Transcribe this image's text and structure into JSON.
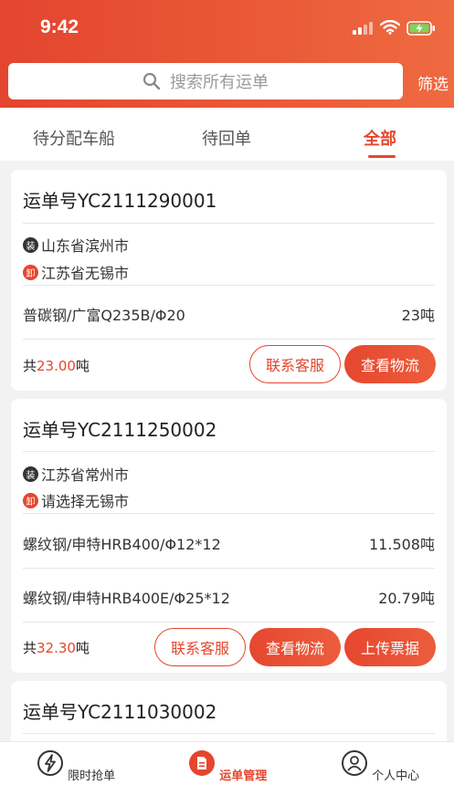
{
  "status_bar": {
    "time": "9:42"
  },
  "search": {
    "placeholder": "搜索所有运单",
    "filter_label": "筛选"
  },
  "tabs": [
    {
      "label": "待分配车船"
    },
    {
      "label": "待回单"
    },
    {
      "label": "全部",
      "active": true
    }
  ],
  "orders": [
    {
      "order_no": "运单号YC2111290001",
      "load_badge": "装",
      "load_address": "山东省滨州市",
      "unload_badge": "卸",
      "unload_address": "江苏省无锡市",
      "items": [
        {
          "name": "普碳钢/广富Q235B/Φ20",
          "weight": "23吨"
        }
      ],
      "total_prefix": "共",
      "total_value": "23.00",
      "total_unit": "吨",
      "buttons": [
        "联系客服",
        "查看物流"
      ]
    },
    {
      "order_no": "运单号YC2111250002",
      "load_badge": "装",
      "load_address": "江苏省常州市",
      "unload_badge": "卸",
      "unload_address": "请选择无锡市",
      "items": [
        {
          "name": "螺纹钢/申特HRB400/Φ12*12",
          "weight": "11.508吨"
        },
        {
          "name": "螺纹钢/申特HRB400E/Φ25*12",
          "weight": "20.79吨"
        }
      ],
      "total_prefix": "共",
      "total_value": "32.30",
      "total_unit": "吨",
      "buttons": [
        "联系客服",
        "查看物流",
        "上传票据"
      ]
    },
    {
      "order_no": "运单号YC2111030002"
    }
  ],
  "tabbar": [
    {
      "label": "限时抢单",
      "icon": "lightning-icon"
    },
    {
      "label": "运单管理",
      "icon": "waybill-icon",
      "active": true
    },
    {
      "label": "个人中心",
      "icon": "user-icon"
    }
  ],
  "colors": {
    "accent": "#e5462d",
    "header_start": "#e4452f",
    "header_end": "#ef6a40"
  }
}
